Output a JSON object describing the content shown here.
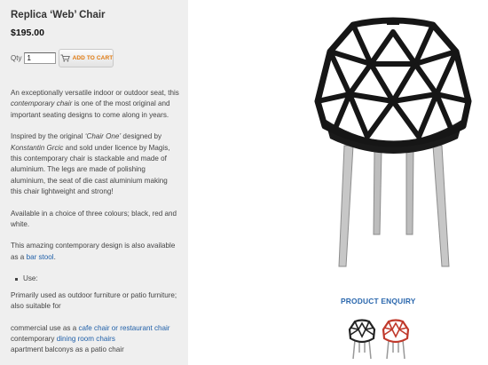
{
  "product": {
    "title": "Replica ‘Web’ Chair",
    "price": "$195.00",
    "qty_label": "Qty",
    "qty_value": "1",
    "add_to_cart": "ADD TO CART"
  },
  "description": {
    "p1_a": "An exceptionally versatile indoor or outdoor seat, this ",
    "p1_em": "contemporary chair",
    "p1_b": " is one of the most original and important seating designs to come along in years.",
    "p2_a": "Inspired by the original ",
    "p2_em1": "‘Chair One’",
    "p2_b": " designed by ",
    "p2_em2": "Konstantin Grcic",
    "p2_c": " and sold under licence by Magis, this contemporary chair is stackable and made of aluminium. The legs are made of polishing aluminium, the seat of die cast aluminium making this chair lightweight and strong!",
    "p3": "Available in a choice of three colours; black, red and white.",
    "p4_a": "This amazing contemporary design is also available as a ",
    "p4_link": "bar stool",
    "p4_b": ".",
    "use_label": "Use:",
    "p5": "Primarily used as outdoor furniture or patio furniture; also suitable for",
    "p6_a": "commercial use as a ",
    "p6_link": "cafe chair or restaurant chair",
    "p6_b": "contemporary ",
    "p6_link2": "dining room chairs",
    "p6_c": "apartment balconys as a patio chair"
  },
  "enquiry_label": "PRODUCT ENQUIRY",
  "thumbnails": [
    {
      "icon": "black-chair-thumbnail",
      "color": "#222222"
    },
    {
      "icon": "red-chair-thumbnail",
      "color": "#c0392b"
    }
  ],
  "colors": {
    "sidebar_bg": "#efefef",
    "link": "#1f5fa8",
    "cart_text": "#e07a10",
    "enquiry": "#2a67ad"
  }
}
